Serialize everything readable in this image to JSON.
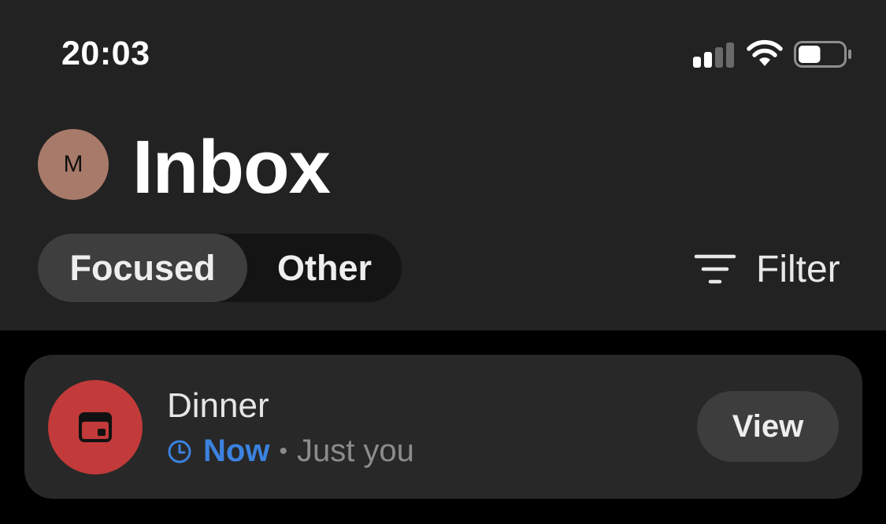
{
  "status_bar": {
    "time": "20:03",
    "signal_bars_active": 2,
    "signal_bars_total": 4,
    "battery_level": 0.5
  },
  "header": {
    "avatar_initial": "M",
    "title": "Inbox"
  },
  "tabs": [
    {
      "label": "Focused",
      "active": true
    },
    {
      "label": "Other",
      "active": false
    }
  ],
  "filter": {
    "label": "Filter",
    "icon": "filter-icon"
  },
  "event": {
    "title": "Dinner",
    "icon": "calendar-icon",
    "time_label": "Now",
    "separator": "•",
    "attendees": "Just you",
    "action_label": "View"
  },
  "colors": {
    "accent_blue": "#3b82e0",
    "event_red": "#c23a3a",
    "avatar_bg": "#a87a6a",
    "header_bg": "#222222",
    "card_bg": "#282828"
  }
}
